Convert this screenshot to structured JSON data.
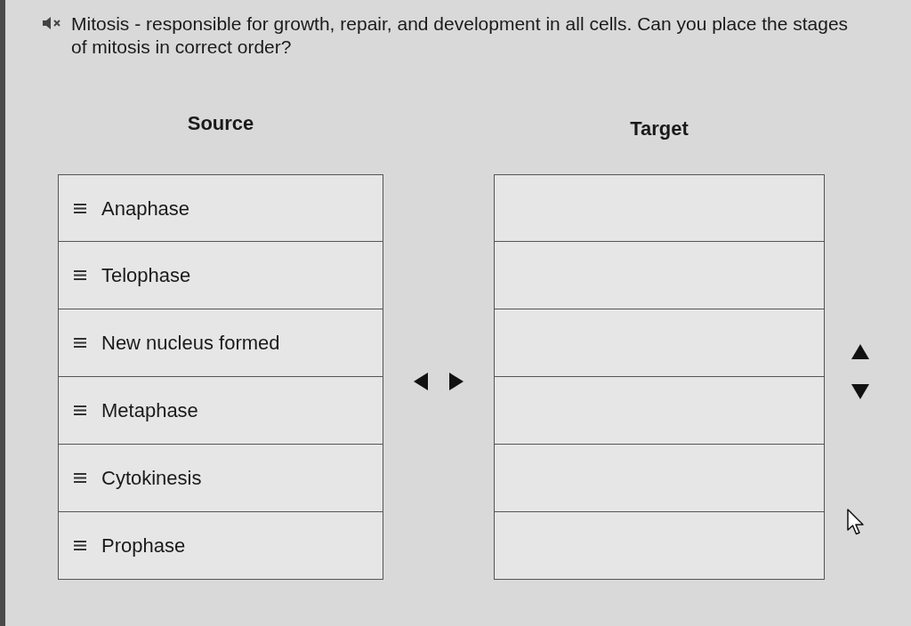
{
  "question": {
    "text": "Mitosis - responsible for growth, repair, and development in all cells. Can you place the stages of mitosis in correct order?"
  },
  "source": {
    "heading": "Source",
    "items": [
      {
        "label": "Anaphase"
      },
      {
        "label": "Telophase"
      },
      {
        "label": "New nucleus formed"
      },
      {
        "label": "Metaphase"
      },
      {
        "label": "Cytokinesis"
      },
      {
        "label": "Prophase"
      }
    ]
  },
  "target": {
    "heading": "Target",
    "slots": [
      {
        "kind": "empty"
      },
      {
        "kind": "empty"
      },
      {
        "kind": "empty"
      },
      {
        "kind": "empty"
      },
      {
        "kind": "empty"
      },
      {
        "kind": "empty"
      }
    ]
  }
}
